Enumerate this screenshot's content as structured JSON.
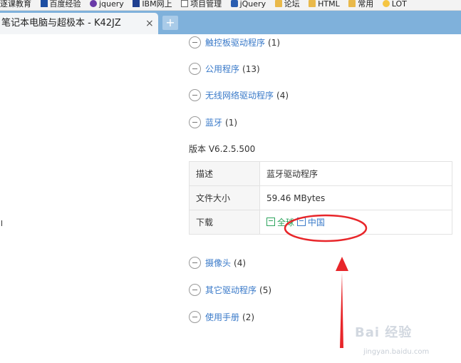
{
  "bookmarks": [
    {
      "label": "逐课教育",
      "icon": "none"
    },
    {
      "label": "百度经验",
      "icon": "page"
    },
    {
      "label": "jquery",
      "icon": "paw"
    },
    {
      "label": "IBM网上",
      "icon": "ibm"
    },
    {
      "label": "项目管理",
      "icon": "check"
    },
    {
      "label": "jQuery",
      "icon": "jq"
    },
    {
      "label": "论坛",
      "icon": "folder"
    },
    {
      "label": "HTML",
      "icon": "folder"
    },
    {
      "label": "常用",
      "icon": "folder"
    },
    {
      "label": "LOT",
      "icon": "bulb"
    }
  ],
  "tab": {
    "title": "笔记本电脑与超极本 - K42JZ",
    "close": "×",
    "new_tab": "+"
  },
  "categories": [
    {
      "name": "触控板驱动程序",
      "count": "(1)"
    },
    {
      "name": "公用程序",
      "count": "(13)"
    },
    {
      "name": "无线网络驱动程序",
      "count": "(4)"
    },
    {
      "name": "蓝牙",
      "count": "(1)"
    }
  ],
  "version": "版本 V6.2.5.500",
  "details": {
    "desc_key": "描述",
    "desc_val": "蓝牙驱动程序",
    "size_key": "文件大小",
    "size_val": "59.46 MBytes",
    "dl_key": "下载",
    "dl_global": "全球",
    "dl_china": "中国"
  },
  "categories_after": [
    {
      "name": "摄像头",
      "count": "(4)"
    },
    {
      "name": "其它驱动程序",
      "count": "(5)"
    },
    {
      "name": "使用手册",
      "count": "(2)"
    }
  ],
  "watermark": {
    "main": "Bai 经验",
    "sub": "jingyan.baidu.com"
  },
  "colors": {
    "link": "#3a7ac9",
    "download_global": "#2ea45e",
    "annotation": "#e8262a",
    "tab_strip": "#7fb1db"
  }
}
